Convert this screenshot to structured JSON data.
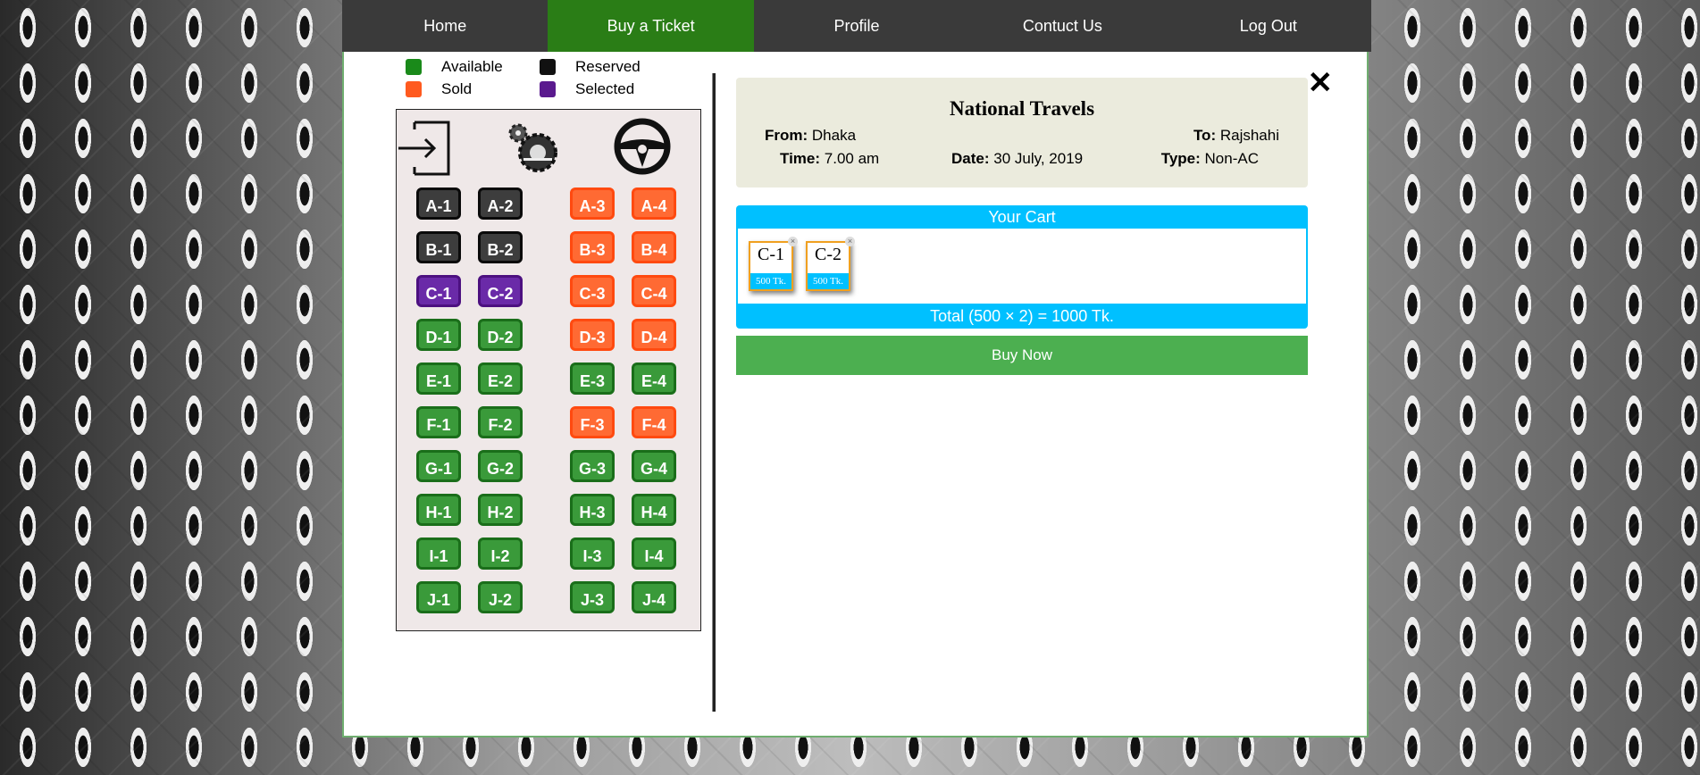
{
  "nav": {
    "items": [
      {
        "label": "Home"
      },
      {
        "label": "Buy a Ticket",
        "active": true
      },
      {
        "label": "Profile"
      },
      {
        "label": "Contuct Us"
      },
      {
        "label": "Log Out"
      }
    ]
  },
  "legend": {
    "available": "Available",
    "reserved": "Reserved",
    "sold": "Sold",
    "selected": "Selected"
  },
  "colors": {
    "available": "#1a8a1a",
    "reserved": "#111111",
    "sold": "#ff5a1f",
    "selected": "#5a1a8e",
    "nav_active": "#2a7d16",
    "cart_accent": "#00c0ff",
    "buy_button": "#4caf50"
  },
  "icons": {
    "door": "door-enter-icon",
    "engine": "engine-gear-icon",
    "steering": "steering-wheel-icon"
  },
  "seats": [
    {
      "id": "A-1",
      "status": "reserved"
    },
    {
      "id": "A-2",
      "status": "reserved"
    },
    {
      "id": "A-3",
      "status": "sold"
    },
    {
      "id": "A-4",
      "status": "sold"
    },
    {
      "id": "B-1",
      "status": "reserved"
    },
    {
      "id": "B-2",
      "status": "reserved"
    },
    {
      "id": "B-3",
      "status": "sold"
    },
    {
      "id": "B-4",
      "status": "sold"
    },
    {
      "id": "C-1",
      "status": "selected"
    },
    {
      "id": "C-2",
      "status": "selected"
    },
    {
      "id": "C-3",
      "status": "sold"
    },
    {
      "id": "C-4",
      "status": "sold"
    },
    {
      "id": "D-1",
      "status": "available"
    },
    {
      "id": "D-2",
      "status": "available"
    },
    {
      "id": "D-3",
      "status": "sold"
    },
    {
      "id": "D-4",
      "status": "sold"
    },
    {
      "id": "E-1",
      "status": "available"
    },
    {
      "id": "E-2",
      "status": "available"
    },
    {
      "id": "E-3",
      "status": "available"
    },
    {
      "id": "E-4",
      "status": "available"
    },
    {
      "id": "F-1",
      "status": "available"
    },
    {
      "id": "F-2",
      "status": "available"
    },
    {
      "id": "F-3",
      "status": "sold"
    },
    {
      "id": "F-4",
      "status": "sold"
    },
    {
      "id": "G-1",
      "status": "available"
    },
    {
      "id": "G-2",
      "status": "available"
    },
    {
      "id": "G-3",
      "status": "available"
    },
    {
      "id": "G-4",
      "status": "available"
    },
    {
      "id": "H-1",
      "status": "available"
    },
    {
      "id": "H-2",
      "status": "available"
    },
    {
      "id": "H-3",
      "status": "available"
    },
    {
      "id": "H-4",
      "status": "available"
    },
    {
      "id": "I-1",
      "status": "available"
    },
    {
      "id": "I-2",
      "status": "available"
    },
    {
      "id": "I-3",
      "status": "available"
    },
    {
      "id": "I-4",
      "status": "available"
    },
    {
      "id": "J-1",
      "status": "available"
    },
    {
      "id": "J-2",
      "status": "available"
    },
    {
      "id": "J-3",
      "status": "available"
    },
    {
      "id": "J-4",
      "status": "available"
    }
  ],
  "trip": {
    "title": "National Travels",
    "from_label": "From:",
    "from": "Dhaka",
    "to_label": "To:",
    "to": "Rajshahi",
    "time_label": "Time:",
    "time": "7.00 am",
    "date_label": "Date:",
    "date": "30 July, 2019",
    "type_label": "Type:",
    "type": "Non-AC"
  },
  "cart": {
    "title": "Your Cart",
    "items": [
      {
        "seat": "C-1",
        "price": "500 Tk."
      },
      {
        "seat": "C-2",
        "price": "500 Tk."
      }
    ],
    "total": "Total (500 × 2) = 1000 Tk.",
    "remove_glyph": "×"
  },
  "buy_label": "Buy Now",
  "close_glyph": "✕"
}
